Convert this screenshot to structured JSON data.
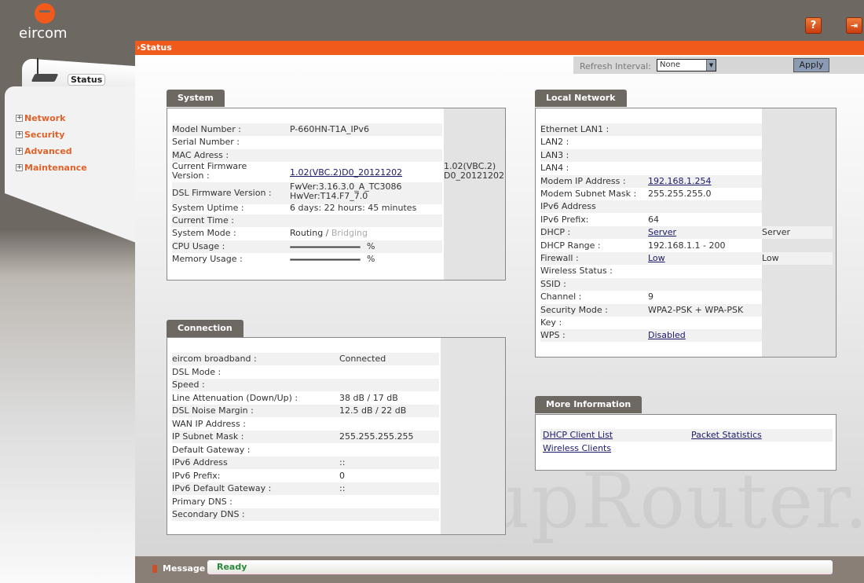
{
  "brand": {
    "logo_text": "eircom"
  },
  "header": {
    "help_icon": "?",
    "logout_icon": "⇥"
  },
  "sidebar": {
    "status_label": "Status",
    "items": [
      {
        "label": "Network"
      },
      {
        "label": "Security"
      },
      {
        "label": "Advanced"
      },
      {
        "label": "Maintenance"
      }
    ]
  },
  "page": {
    "title": "Status",
    "refresh_label": "Refresh Interval:",
    "refresh_value": "None",
    "apply_label": "Apply"
  },
  "system": {
    "title": "System",
    "rows": [
      {
        "label": "Model Number :",
        "value": "P-660HN-T1A_IPv6"
      },
      {
        "label": "Serial Number :",
        "value": ""
      },
      {
        "label": "MAC Adress :",
        "value": ""
      },
      {
        "label": "Current Firmware",
        "label2": "Version :",
        "value": "1.02(VBC.2)D0_20121202",
        "extra": "1.02(VBC.2)",
        "extra2": "D0_20121202"
      },
      {
        "label": "DSL Firmware Version :",
        "value": "FwVer:3.16.3.0_A_TC3086",
        "value2": "HwVer:T14.F7_7.0"
      },
      {
        "label": "System Uptime :",
        "value": "6 days: 22 hours: 45 minutes"
      },
      {
        "label": "Current Time :",
        "value": ""
      },
      {
        "label": "System Mode :",
        "value": "Routing",
        "sep": " / ",
        "value_muted": "Bridging"
      },
      {
        "label": "CPU Usage :",
        "unit": "%"
      },
      {
        "label": "Memory Usage :",
        "unit": "%"
      }
    ]
  },
  "connection": {
    "title": "Connection",
    "rows": [
      {
        "label": "eircom broadband :",
        "value": "Connected"
      },
      {
        "label": "DSL Mode :",
        "value": ""
      },
      {
        "label": "Speed :",
        "value": ""
      },
      {
        "label": "Line Attenuation (Down/Up) :",
        "value": "38 dB / 17 dB"
      },
      {
        "label": "DSL Noise Margin :",
        "value": "12.5 dB / 22 dB"
      },
      {
        "label": "WAN IP Address :",
        "value": ""
      },
      {
        "label": "IP Subnet Mask :",
        "value": "255.255.255.255"
      },
      {
        "label": "Default Gateway :",
        "value": ""
      },
      {
        "label": "IPv6 Address",
        "value": "::"
      },
      {
        "label": "IPv6 Prefix:",
        "value": "0"
      },
      {
        "label": "IPv6 Default Gateway :",
        "value": "::"
      },
      {
        "label": "Primary DNS :",
        "value": ""
      },
      {
        "label": "Secondary DNS :",
        "value": ""
      }
    ]
  },
  "local_network": {
    "title": "Local Network",
    "rows": [
      {
        "label": "Ethernet LAN1 :",
        "value": ""
      },
      {
        "label": "LAN2 :",
        "value": ""
      },
      {
        "label": "LAN3 :",
        "value": ""
      },
      {
        "label": "LAN4 :",
        "value": ""
      },
      {
        "label": "Modem IP Address :",
        "value": "192.168.1.254",
        "link": true
      },
      {
        "label": "Modem Subnet Mask :",
        "value": "255.255.255.0"
      },
      {
        "label": "IPv6 Address",
        "value": ""
      },
      {
        "label": "IPv6 Prefix:",
        "value": "64"
      },
      {
        "label": "DHCP :",
        "value": "Server",
        "link": true,
        "extra": "Server"
      },
      {
        "label": "DHCP Range :",
        "value": "192.168.1.1 - 200"
      },
      {
        "label": "Firewall :",
        "value": "Low",
        "link": true,
        "extra": "Low"
      },
      {
        "label": "Wireless Status :",
        "value": ""
      },
      {
        "label": "SSID :",
        "value": ""
      },
      {
        "label": "Channel :",
        "value": "9"
      },
      {
        "label": "Security Mode :",
        "value": "WPA2-PSK + WPA-PSK"
      },
      {
        "label": "Key :",
        "value": ""
      },
      {
        "label": "WPS :",
        "value": "Disabled",
        "link": true
      }
    ]
  },
  "more_info": {
    "title": "More Information",
    "links": [
      "DHCP Client List",
      "Packet Statistics",
      "Wireless Clients"
    ]
  },
  "message_bar": {
    "label": "Message",
    "text": "Ready"
  },
  "watermark": "setupRouter.com"
}
